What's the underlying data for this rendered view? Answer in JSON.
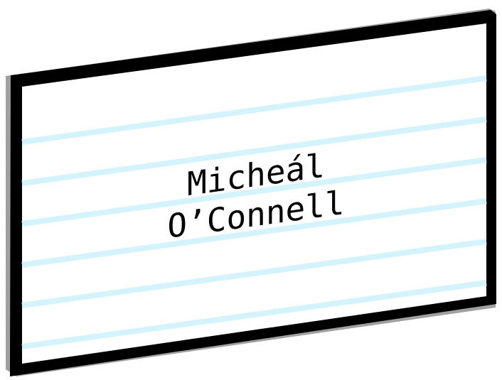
{
  "card": {
    "name_line_1": "Micheál",
    "name_line_2": "O’Connell"
  },
  "colors": {
    "background": "#ffffff",
    "card_face": "#ffffff",
    "card_border": "#000000",
    "card_side": "#a0a0a0",
    "rule_lines": "#d4f3fc",
    "text": "#000000"
  }
}
